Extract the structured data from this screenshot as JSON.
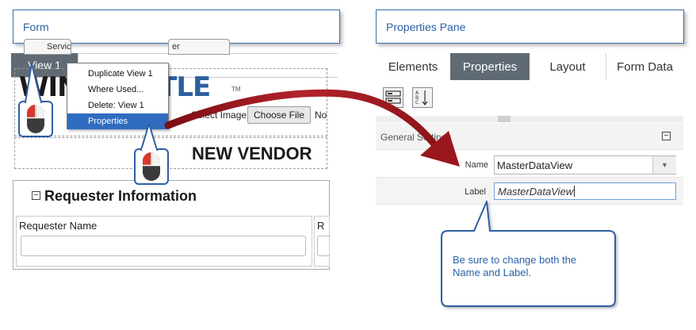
{
  "callouts": {
    "form": "Form",
    "properties_pane": "Properties Pane"
  },
  "form": {
    "view_tab": "View 1",
    "context_menu": {
      "items": [
        "Duplicate View 1",
        "Where Used...",
        "Delete: View 1",
        "Properties"
      ],
      "highlighted_index": 3
    },
    "subtabs": [
      "Servic",
      "er"
    ],
    "logo": {
      "part1": "WIN",
      "part2": "SHUTTLE",
      "tm": "TM"
    },
    "select_image_label": "Select Image:",
    "choose_file_button": "Choose File",
    "no_file_text": "No",
    "vendor_title": "NEW VENDOR",
    "section_title": "Requester Information",
    "field_label": "Requester Name",
    "field_label_2": "R"
  },
  "pane": {
    "tabs": [
      "Elements",
      "Properties",
      "Layout",
      "Form Data"
    ],
    "active_tab": "Properties",
    "group_title": "General Settings",
    "name_label": "Name",
    "name_value": "MasterDataView",
    "label_label": "Label",
    "label_value": "MasterDataView"
  },
  "note": "Be sure to change both the Name and Label.",
  "colors": {
    "accent_blue": "#2a62a6",
    "tab_active": "#606a74",
    "menu_highlight": "#2f6cc0",
    "arrow": "#a0161c",
    "logo_blue": "#2c5f9e"
  }
}
